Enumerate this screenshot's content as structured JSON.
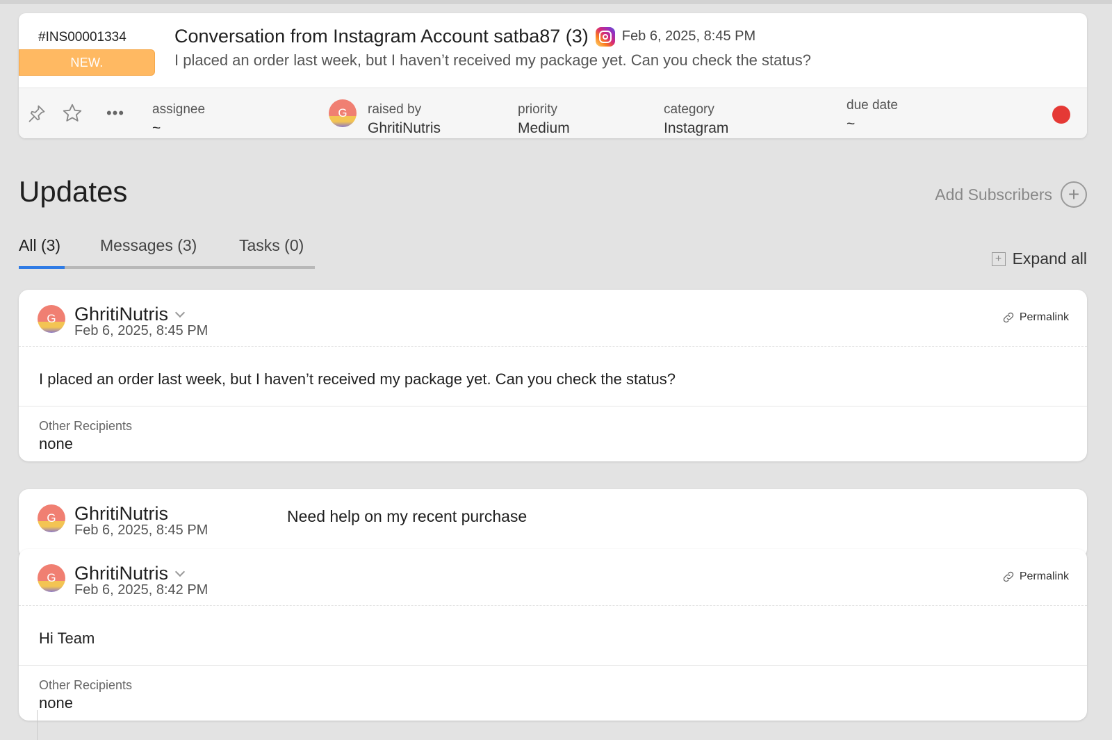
{
  "ticket": {
    "id": "#INS00001334",
    "status": "NEW.",
    "title": "Conversation from Instagram Account satba87 (3)",
    "title_icon": "instagram-icon",
    "date": "Feb 6, 2025, 8:45 PM",
    "description": "I placed an order last week, but I haven’t received my package yet. Can you check the status?",
    "fields": {
      "assignee_label": "assignee",
      "assignee_value": "~",
      "raised_by_label": "raised by",
      "raised_by_value": "GhritiNutris",
      "raised_by_avatar": "G",
      "priority_label": "priority",
      "priority_value": "Medium",
      "category_label": "category",
      "category_value": "Instagram",
      "due_date_label": "due date",
      "due_date_value": "~"
    },
    "status_color": "#e53935"
  },
  "updates": {
    "title": "Updates",
    "add_subscribers": "Add Subscribers",
    "expand_all": "Expand all",
    "tabs": [
      {
        "label": "All (3)"
      },
      {
        "label": "Messages (3)"
      },
      {
        "label": "Tasks (0)"
      }
    ]
  },
  "messages": [
    {
      "avatar": "G",
      "author": "GhritiNutris",
      "date": "Feb 6, 2025, 8:45 PM",
      "permalink": "Permalink",
      "body": "I placed an order last week, but I haven’t received my package yet. Can you check the status?",
      "recipients_label": "Other Recipients",
      "recipients_value": "none"
    },
    {
      "avatar": "G",
      "author": "GhritiNutris",
      "date": "Feb 6, 2025, 8:45 PM",
      "subject": "Need help on my recent purchase"
    },
    {
      "avatar": "G",
      "author": "GhritiNutris",
      "date": "Feb 6, 2025, 8:42 PM",
      "permalink": "Permalink",
      "body": "Hi Team",
      "recipients_label": "Other Recipients",
      "recipients_value": "none"
    }
  ],
  "colors": {
    "accent": "#2f7be5",
    "status_new": "#ffb962",
    "background": "#e3e3e3"
  }
}
